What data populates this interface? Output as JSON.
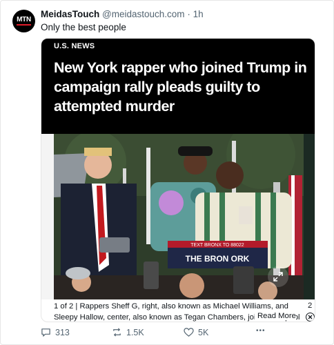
{
  "post": {
    "avatar_text": "MTN",
    "display_name": "MeidasTouch",
    "handle": "@meidastouch.com",
    "separator": "·",
    "time": "1h",
    "text": "Only the best people"
  },
  "card": {
    "section_label": "U.S. NEWS",
    "headline": "New York rapper who joined Trump in campaign rally pleads guilty to attempted murder",
    "photo_sign": "TEXT BRONX TO 88022",
    "photo_sign_sub": "THE BRON     ORK",
    "caption_counter": "1 of 2 |",
    "caption_text": "Rappers Sheff G, right, also known as Michael Williams, and Sleepy Hallow, center, also known as Tegan Chambers, join the Republ",
    "read_more": "Read More",
    "next_index": "2"
  },
  "actions": {
    "replies": "313",
    "reposts": "1.5K",
    "likes": "5K",
    "more": "•••"
  },
  "colors": {
    "accent_red": "#e11d2a",
    "muted": "#536471",
    "headline_bg": "#000000"
  },
  "icons": [
    "reply-icon",
    "repost-icon",
    "like-icon",
    "more-icon",
    "expand-icon",
    "close-icon"
  ]
}
